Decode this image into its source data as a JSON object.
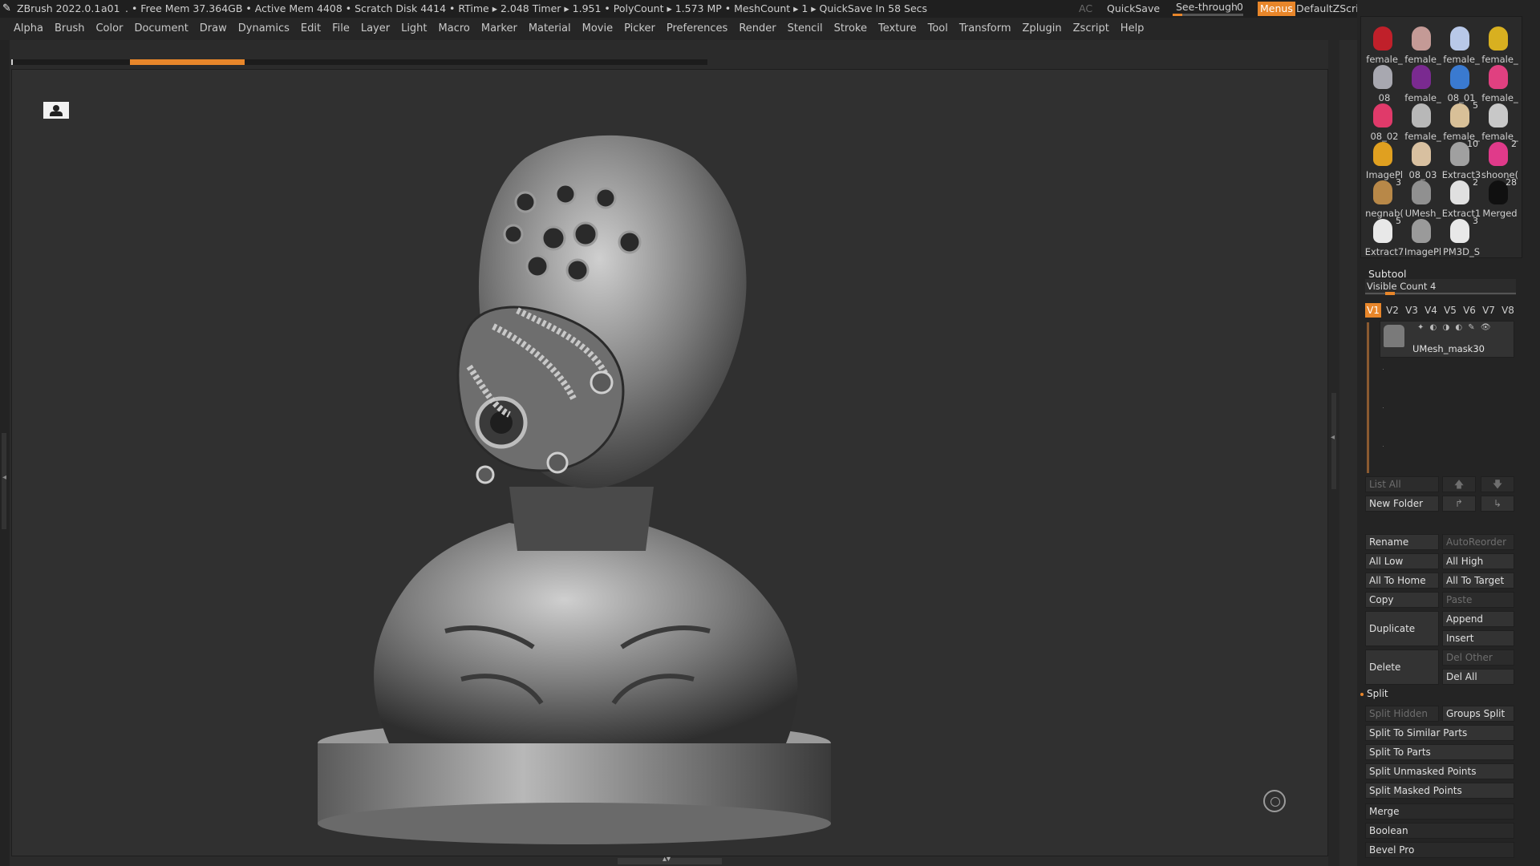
{
  "titlebar": {
    "app": "ZBrush 2022.0.1",
    "doc": "a01",
    "stats": ". • Free Mem 37.364GB • Active Mem 4408 • Scratch Disk 4414 •  RTime ▸ 2.048 Timer ▸ 1.951 • PolyCount ▸ 1.573 MP  • MeshCount ▸ 1   ▸ QuickSave In 58 Secs",
    "ac": "AC",
    "quicksave": "QuickSave",
    "seethrough": "See-through",
    "seethrough_value": "0",
    "menus": "Menus",
    "script": "DefaultZScript"
  },
  "menubar": [
    "Alpha",
    "Brush",
    "Color",
    "Document",
    "Draw",
    "Dynamics",
    "Edit",
    "File",
    "Layer",
    "Light",
    "Macro",
    "Marker",
    "Material",
    "Movie",
    "Picker",
    "Preferences",
    "Render",
    "Stencil",
    "Stroke",
    "Texture",
    "Tool",
    "Transform",
    "Zplugin",
    "Zscript",
    "Help"
  ],
  "tools": [
    {
      "label": "female_",
      "color": "#c0202a",
      "count": ""
    },
    {
      "label": "female_",
      "color": "#c49a96",
      "count": ""
    },
    {
      "label": "female_",
      "color": "#b8c8e8",
      "count": ""
    },
    {
      "label": "female_",
      "color": "#d8b020",
      "count": ""
    },
    {
      "label": "08",
      "color": "#a8a8b0",
      "count": ""
    },
    {
      "label": "female_",
      "color": "#7a2a90",
      "count": ""
    },
    {
      "label": "08_01",
      "color": "#3a7ad0",
      "count": ""
    },
    {
      "label": "female_",
      "color": "#e04080",
      "count": ""
    },
    {
      "label": "08_02",
      "color": "#e03a6a",
      "count": ""
    },
    {
      "label": "female_",
      "color": "#b8b8b8",
      "count": ""
    },
    {
      "label": "female_",
      "color": "#d8c098",
      "count": "5"
    },
    {
      "label": "female_",
      "color": "#c8c8c8",
      "count": ""
    },
    {
      "label": "ImagePl",
      "color": "#e0a020",
      "count": ""
    },
    {
      "label": "08_03",
      "color": "#d8c0a0",
      "count": ""
    },
    {
      "label": "Extract3",
      "color": "#a0a0a0",
      "count": "10"
    },
    {
      "label": "shoone(",
      "color": "#e03a8a",
      "count": "2"
    },
    {
      "label": "negnab(",
      "color": "#b88848",
      "count": "3"
    },
    {
      "label": "UMesh_",
      "color": "#909090",
      "count": ""
    },
    {
      "label": "Extract1",
      "color": "#e0e0e0",
      "count": "2"
    },
    {
      "label": "Merged",
      "color": "#101010",
      "count": "28"
    },
    {
      "label": "Extract7",
      "color": "#e8e8e8",
      "count": "5"
    },
    {
      "label": "ImagePl",
      "color": "#9a9a9a",
      "count": ""
    },
    {
      "label": "PM3D_S",
      "color": "#e8e8e8",
      "count": "3"
    }
  ],
  "subtool": {
    "title": "Subtool",
    "visible_count": "Visible Count 4",
    "vtabs": [
      "V1",
      "V2",
      "V3",
      "V4",
      "V5",
      "V6",
      "V7",
      "V8"
    ],
    "item_name": "UMesh_mask30",
    "list_all": "List All",
    "new_folder": "New Folder",
    "rename": "Rename",
    "autoreorder": "AutoReorder",
    "all_low": "All Low",
    "all_high": "All High",
    "all_to_home": "All To Home",
    "all_to_target": "All To Target",
    "copy": "Copy",
    "paste": "Paste",
    "duplicate": "Duplicate",
    "append": "Append",
    "insert": "Insert",
    "delete": "Delete",
    "del_other": "Del Other",
    "del_all": "Del All",
    "split": "Split",
    "split_hidden": "Split Hidden",
    "groups_split": "Groups Split",
    "split_similar": "Split To Similar Parts",
    "split_parts": "Split To Parts",
    "split_unmasked": "Split Unmasked Points",
    "split_masked": "Split Masked Points",
    "merge": "Merge",
    "boolean": "Boolean",
    "bevel_pro": "Bevel Pro"
  },
  "colors": {
    "accent": "#e8862a",
    "bg": "#2b2b2b",
    "panel": "#242424"
  }
}
